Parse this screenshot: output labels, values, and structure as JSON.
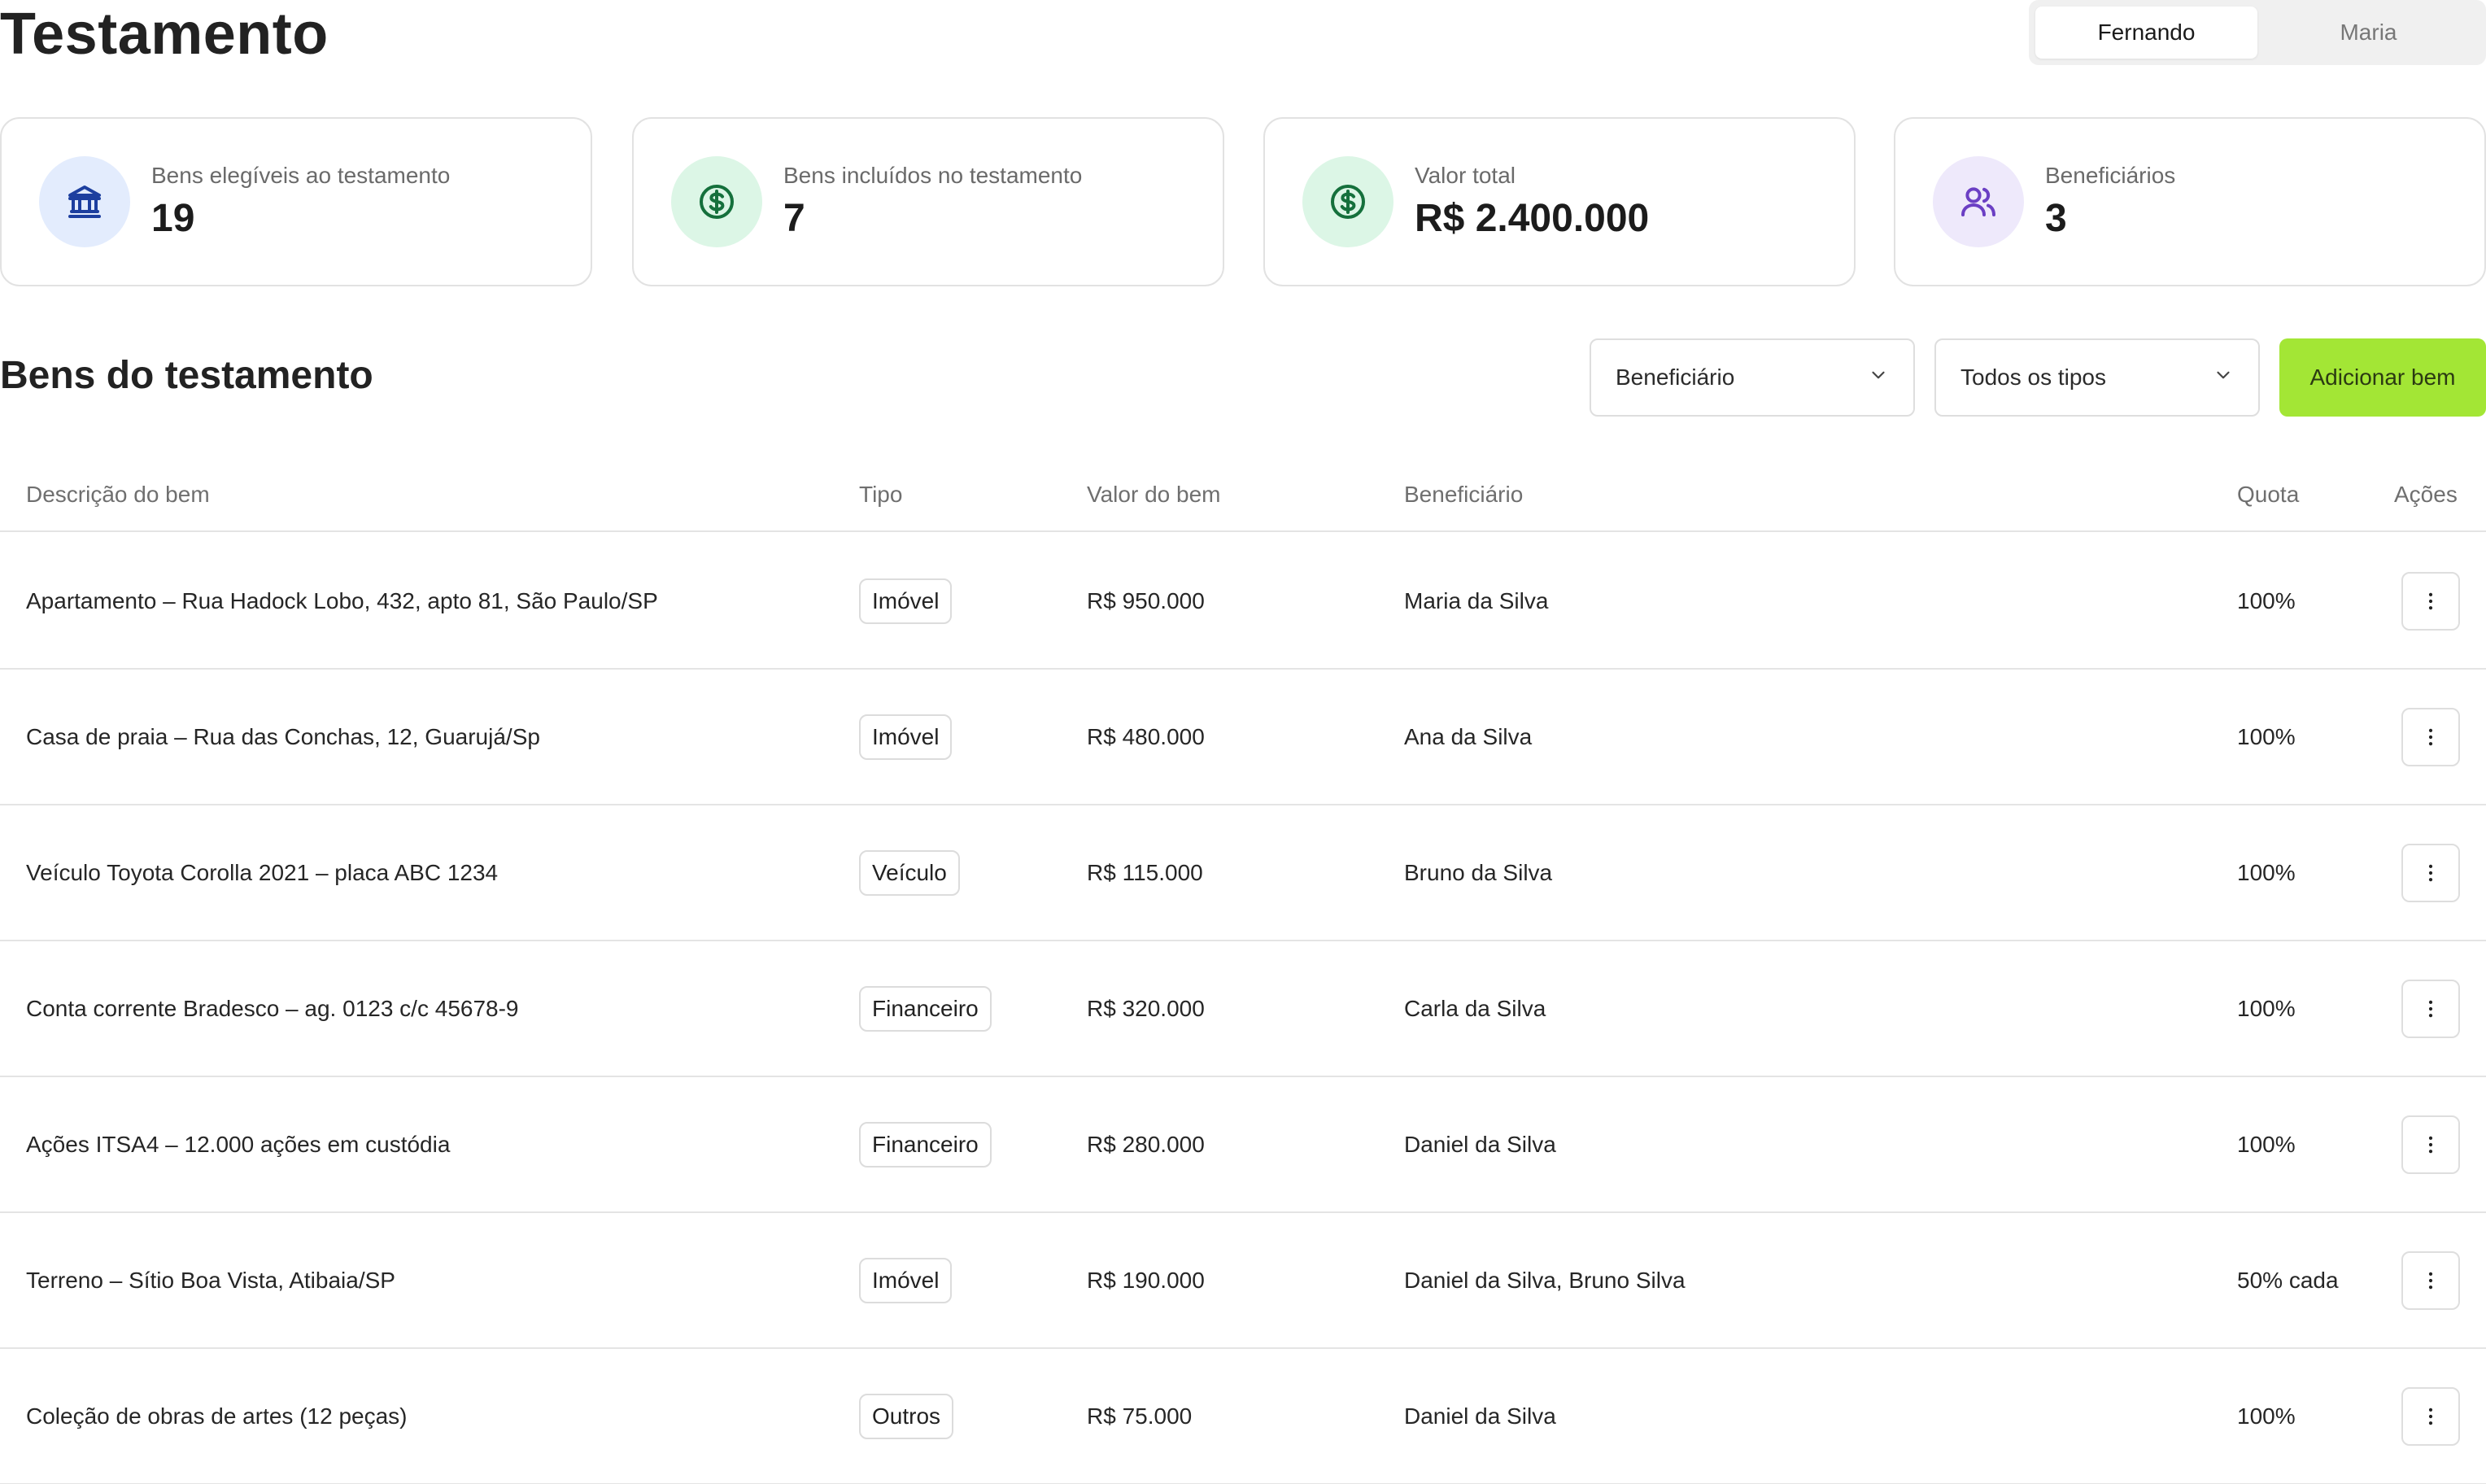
{
  "header": {
    "title": "Testamento",
    "toggle": {
      "options": [
        "Fernando",
        "Maria"
      ],
      "active": "Fernando"
    }
  },
  "stats": [
    {
      "label": "Bens elegíveis ao testamento",
      "value": "19",
      "icon": "bank-icon",
      "icon_bg": "#e3ecfd",
      "icon_color": "#1d3f9f"
    },
    {
      "label": "Bens incluídos no testamento",
      "value": "7",
      "icon": "dollar-circle-icon",
      "icon_bg": "#dcf6e6",
      "icon_color": "#15703c"
    },
    {
      "label": "Valor total",
      "value": "R$ 2.400.000",
      "icon": "dollar-circle-icon",
      "icon_bg": "#dcf6e6",
      "icon_color": "#15703c"
    },
    {
      "label": "Beneficiários",
      "value": "3",
      "icon": "users-icon",
      "icon_bg": "#eee9fb",
      "icon_color": "#6b3fc4"
    }
  ],
  "section": {
    "title": "Bens do testamento",
    "filter_beneficiary": "Beneficiário",
    "filter_type": "Todos os tipos",
    "add_button": "Adicionar bem",
    "accent": "#a3e635"
  },
  "table": {
    "columns": [
      "Descrição do bem",
      "Tipo",
      "Valor do bem",
      "Beneficiário",
      "Quota",
      "Ações"
    ],
    "rows": [
      {
        "descricao": "Apartamento – Rua Hadock Lobo, 432, apto 81, São Paulo/SP",
        "tipo": "Imóvel",
        "valor": "R$ 950.000",
        "beneficiario": "Maria da Silva",
        "quota": "100%"
      },
      {
        "descricao": "Casa de praia – Rua das Conchas, 12, Guarujá/Sp",
        "tipo": "Imóvel",
        "valor": "R$ 480.000",
        "beneficiario": "Ana da Silva",
        "quota": "100%"
      },
      {
        "descricao": "Veículo Toyota Corolla 2021 – placa ABC 1234",
        "tipo": "Veículo",
        "valor": "R$ 115.000",
        "beneficiario": "Bruno da Silva",
        "quota": "100%"
      },
      {
        "descricao": "Conta corrente Bradesco – ag. 0123 c/c 45678-9",
        "tipo": "Financeiro",
        "valor": "R$ 320.000",
        "beneficiario": "Carla da Silva",
        "quota": "100%"
      },
      {
        "descricao": "Ações ITSA4 – 12.000 ações em custódia",
        "tipo": "Financeiro",
        "valor": "R$ 280.000",
        "beneficiario": "Daniel da Silva",
        "quota": "100%"
      },
      {
        "descricao": "Terreno – Sítio Boa Vista, Atibaia/SP",
        "tipo": "Imóvel",
        "valor": "R$ 190.000",
        "beneficiario": "Daniel da Silva, Bruno Silva",
        "quota": "50% cada"
      },
      {
        "descricao": "Coleção de obras de artes (12 peças)",
        "tipo": "Outros",
        "valor": "R$ 75.000",
        "beneficiario": "Daniel da Silva",
        "quota": "100%"
      }
    ]
  }
}
